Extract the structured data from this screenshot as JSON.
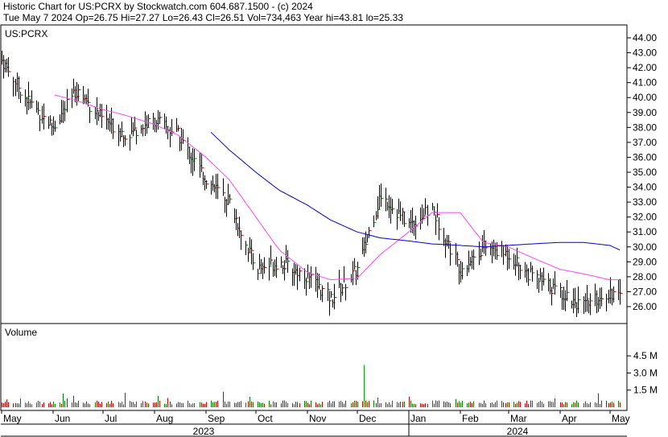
{
  "header": {
    "line1": "Historic Chart for US:PCRX by Stockwatch.com 604.687.1500 - (c) 2024",
    "line2": "Tue May  7 2024  Op=26.75  Hi=27.27  Lo=26.43  Cl=26.51  Vol=734,463  Year hi=43.81  lo=25.33"
  },
  "colors": {
    "background": "#ffffff",
    "frame": "#000000",
    "price_bar": "#000000",
    "up_tick": "#008000",
    "down_tick": "#cc0000",
    "ma_short": "#ff44ff",
    "ma_long": "#0000cc",
    "volume_spike": "#00aa00"
  },
  "chart_data": [
    {
      "type": "line",
      "title": "US:PCRX",
      "ylim": [
        25.0,
        44.6
      ],
      "y_ticks": [
        "44.00",
        "43.00",
        "42.00",
        "41.00",
        "40.00",
        "39.00",
        "38.00",
        "37.00",
        "36.00",
        "35.00",
        "34.00",
        "33.00",
        "32.00",
        "31.00",
        "30.00",
        "29.00",
        "28.00",
        "27.00",
        "26.00"
      ],
      "x": [
        "2023-05-01",
        "2023-05-15",
        "2023-06-01",
        "2023-06-15",
        "2023-07-01",
        "2023-07-15",
        "2023-08-01",
        "2023-08-15",
        "2023-09-01",
        "2023-09-15",
        "2023-10-01",
        "2023-10-15",
        "2023-11-01",
        "2023-11-15",
        "2023-12-01",
        "2023-12-15",
        "2024-01-01",
        "2024-01-15",
        "2024-02-01",
        "2024-02-15",
        "2024-03-01",
        "2024-03-15",
        "2024-04-01",
        "2024-04-15",
        "2024-05-01",
        "2024-05-07"
      ],
      "series": [
        {
          "values": [
            42.5,
            40.0,
            38.0,
            40.5,
            38.5,
            37.5,
            38.5,
            37.5,
            34.5,
            33.0,
            28.5,
            29.0,
            28.0,
            26.5,
            28.5,
            33.5,
            31.5,
            32.5,
            28.5,
            30.0,
            29.5,
            28.0,
            27.0,
            26.0,
            27.0,
            26.51
          ]
        },
        {
          "values": [
            null,
            null,
            40.2,
            39.8,
            39.2,
            38.8,
            38.2,
            37.5,
            36.0,
            34.5,
            32.0,
            29.8,
            28.3,
            27.8,
            27.9,
            29.5,
            31.0,
            32.3,
            32.3,
            30.3,
            30.0,
            29.3,
            28.5,
            28.2,
            27.8,
            27.8
          ]
        },
        {
          "values": [
            null,
            null,
            null,
            null,
            null,
            null,
            null,
            null,
            38.0,
            36.5,
            35.0,
            33.8,
            32.8,
            31.8,
            31.0,
            30.6,
            30.4,
            30.2,
            30.1,
            30.0,
            30.1,
            30.2,
            30.3,
            30.3,
            30.1,
            29.8
          ]
        }
      ]
    },
    {
      "type": "bar",
      "title": "Volume",
      "ylim": [
        0,
        5.5
      ],
      "y_ticks": [
        "4.5 M",
        "3.0 M",
        "1.5 M"
      ],
      "spike": {
        "date": "2023-12-05",
        "value": 3.7
      }
    }
  ],
  "x_axis": {
    "months": [
      "May",
      "Jun",
      "Jul",
      "Aug",
      "Sep",
      "Oct",
      "Nov",
      "Dec",
      "Jan",
      "Feb",
      "Mar",
      "Apr",
      "May"
    ],
    "years": [
      "2023",
      "2024"
    ]
  }
}
